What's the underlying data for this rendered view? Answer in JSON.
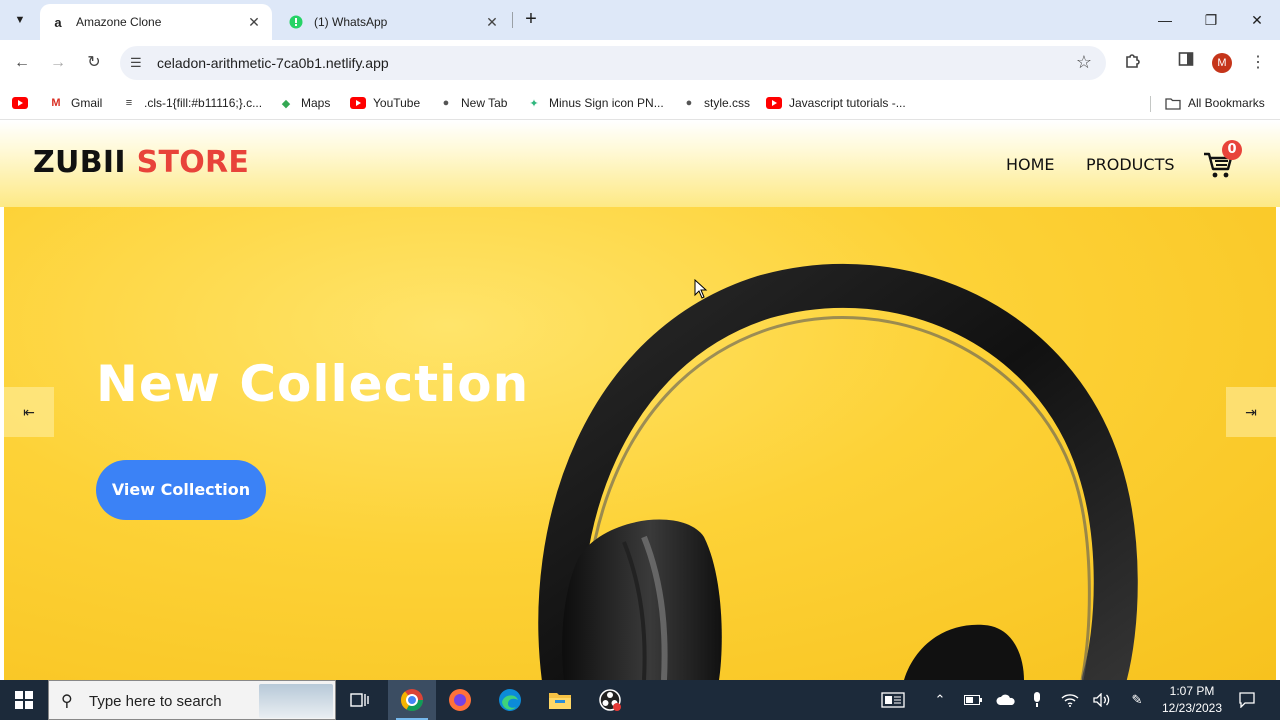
{
  "browser": {
    "tabs": [
      {
        "title": "Amazone Clone",
        "favicon": "amazon-a-icon",
        "active": true
      },
      {
        "title": "(1) WhatsApp",
        "favicon": "whatsapp-icon",
        "active": false
      }
    ],
    "url": "celadon-arithmetic-7ca0b1.netlify.app",
    "profile_initial": "M"
  },
  "bookmarks": [
    {
      "label": "Gmail",
      "icon": "gmail-icon"
    },
    {
      "label": ".cls-1{fill:#b11116;}.c...",
      "icon": "stack-icon"
    },
    {
      "label": "Maps",
      "icon": "maps-icon"
    },
    {
      "label": "YouTube",
      "icon": "youtube-icon"
    },
    {
      "label": "New Tab",
      "icon": "globe-icon"
    },
    {
      "label": "Minus Sign icon PN...",
      "icon": "leaf-icon"
    },
    {
      "label": "style.css",
      "icon": "globe-icon"
    },
    {
      "label": "Javascript tutorials -...",
      "icon": "youtube-icon"
    }
  ],
  "all_bookmarks": "All Bookmarks",
  "site": {
    "logo_part1": "ZUBII",
    "logo_part2": "STORE",
    "nav": [
      "HOME",
      "PRODUCTS"
    ],
    "cart_count": "0",
    "hero_title": "New Collection",
    "hero_button": "View Collection",
    "colors": {
      "accent_red": "#e8433a",
      "hero_yellow": "#fdd237",
      "button_blue": "#3b82f6"
    }
  },
  "taskbar": {
    "search_placeholder": "Type here to search",
    "time": "1:07 PM",
    "date": "12/23/2023"
  }
}
